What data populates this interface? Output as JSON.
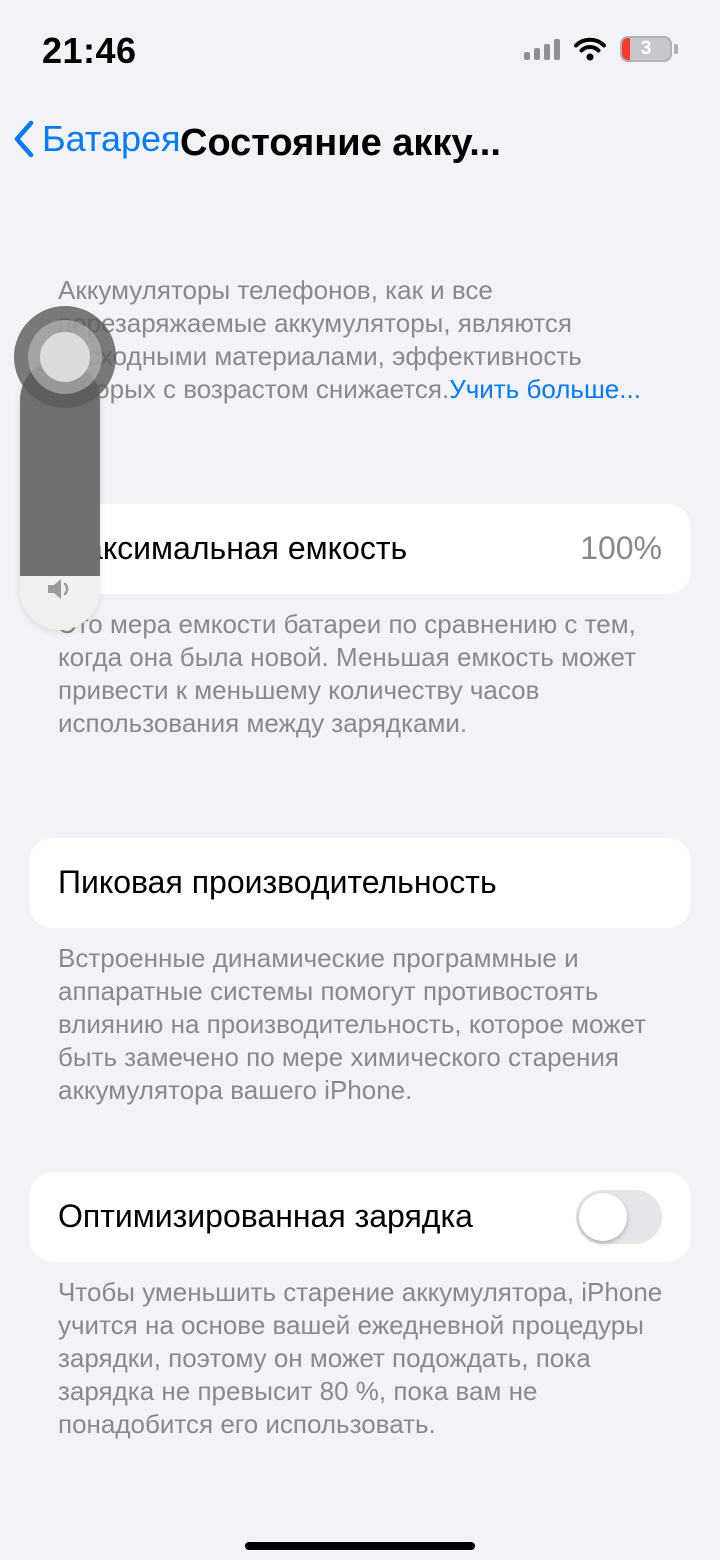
{
  "status_bar": {
    "time": "21:46",
    "battery_level": "3"
  },
  "nav": {
    "back_label": "Батарея",
    "title": "Состояние акку..."
  },
  "intro": {
    "text": "Аккумуляторы телефонов, как и все перезаряжаемые аккумуляторы, являются расходными материалами, эффективность которых с возрастом снижается.",
    "link": "Учить больше..."
  },
  "max_capacity": {
    "label": "Максимальная емкость",
    "value": "100%",
    "footnote": "Это мера емкости батареи по сравнению с тем, когда она была новой. Меньшая емкость может привести к меньшему количеству часов использования между зарядками."
  },
  "peak_performance": {
    "label": "Пиковая производительность",
    "footnote": "Встроенные динамические программные и аппаратные системы помогут противостоять влиянию на производительность, которое может быть замечено по мере химического старения аккумулятора вашего iPhone."
  },
  "optimized_charging": {
    "label": "Оптимизированная зарядка",
    "enabled": false,
    "footnote": "Чтобы уменьшить старение аккумулятора, iPhone учится на основе вашей ежедневной процедуры зарядки, поэтому он может подождать, пока зарядка не превысит 80 %, пока вам не понадобится его использовать."
  },
  "volume_overlay": {
    "level": 0.8
  },
  "icons": {
    "back": "chevron-left-icon",
    "signal": "cellular-signal-icon",
    "wifi": "wifi-icon",
    "battery": "battery-icon",
    "speaker": "speaker-icon",
    "assistive_touch": "assistive-touch-icon"
  },
  "colors": {
    "accent": "#007aff",
    "background": "#f2f2f7",
    "battery_low": "#ff3b30"
  }
}
